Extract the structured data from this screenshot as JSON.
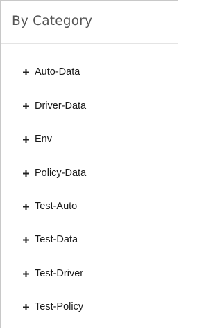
{
  "panel": {
    "title": "By Category"
  },
  "tree": {
    "items": [
      {
        "label": "Auto-Data",
        "expander_icon": "plus-icon"
      },
      {
        "label": "Driver-Data",
        "expander_icon": "plus-icon"
      },
      {
        "label": "Env",
        "expander_icon": "plus-icon"
      },
      {
        "label": "Policy-Data",
        "expander_icon": "plus-icon"
      },
      {
        "label": "Test-Auto",
        "expander_icon": "plus-icon"
      },
      {
        "label": "Test-Data",
        "expander_icon": "plus-icon"
      },
      {
        "label": "Test-Driver",
        "expander_icon": "plus-icon"
      },
      {
        "label": "Test-Policy",
        "expander_icon": "plus-icon"
      }
    ]
  },
  "colors": {
    "title_text": "#555555",
    "item_text": "#1a1a1a",
    "border": "#c8c8c8"
  }
}
